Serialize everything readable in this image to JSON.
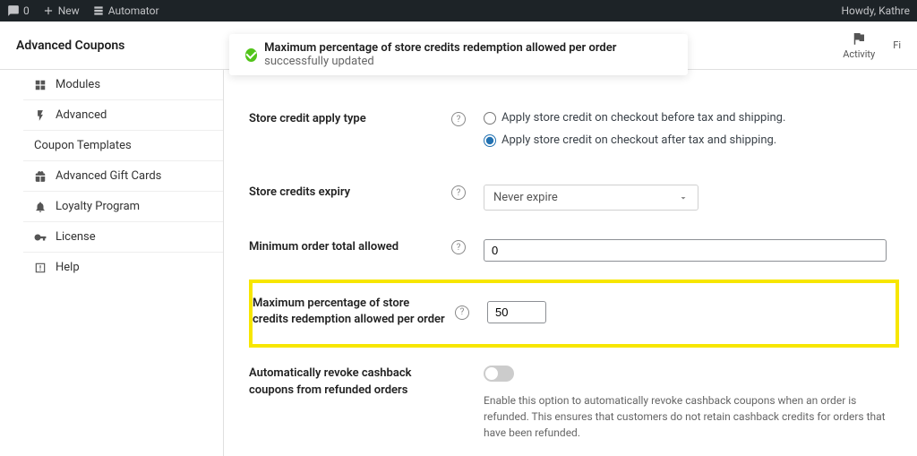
{
  "adminBar": {
    "commentCount": "0",
    "new": "New",
    "automator": "Automator",
    "greeting": "Howdy, Kathre"
  },
  "header": {
    "title": "Advanced Coupons",
    "activity": "Activity",
    "finish": "Fi"
  },
  "toast": {
    "bold": "Maximum percentage of store credits redemption allowed per order",
    "suffix": " successfully updated"
  },
  "sidebar": {
    "items": [
      {
        "label": "Modules",
        "icon": "modules"
      },
      {
        "label": "Advanced",
        "icon": "bolt"
      },
      {
        "label": "Coupon Templates",
        "icon": ""
      },
      {
        "label": "Advanced Gift Cards",
        "icon": "gift"
      },
      {
        "label": "Loyalty Program",
        "icon": "bell"
      },
      {
        "label": "License",
        "icon": "key"
      },
      {
        "label": "Help",
        "icon": "help"
      }
    ]
  },
  "form": {
    "applyType": {
      "label": "Store credit apply type",
      "option1": "Apply store credit on checkout before tax and shipping.",
      "option2": "Apply store credit on checkout after tax and shipping."
    },
    "expiry": {
      "label": "Store credits expiry",
      "value": "Never expire"
    },
    "minOrder": {
      "label": "Minimum order total allowed",
      "value": "0"
    },
    "maxPct": {
      "label": "Maximum percentage of store credits redemption allowed per order",
      "value": "50"
    },
    "revoke": {
      "label": "Automatically revoke cashback coupons from refunded orders",
      "hint": "Enable this option to automatically revoke cashback coupons when an order is refunded. This ensures that customers do not retain cashback credits for orders that have been refunded."
    }
  }
}
